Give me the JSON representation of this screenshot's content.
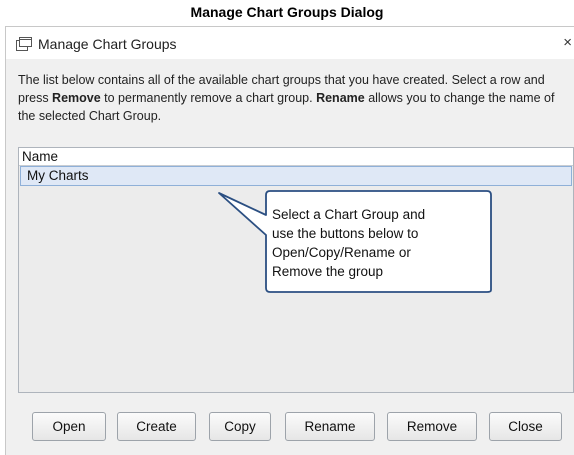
{
  "caption": "Manage Chart Groups Dialog",
  "dialog": {
    "title": "Manage Chart Groups",
    "close_glyph": "×",
    "icon": "window-icon",
    "description": {
      "p1": "The list below contains all of the available chart groups that you have created. Select a row and press ",
      "remove_word": "Remove",
      "p2": " to permanently remove a chart group. ",
      "rename_word": "Rename",
      "p3": " allows you to change the name of the selected Chart Group."
    },
    "list": {
      "column_header": "Name",
      "rows": [
        "My Charts"
      ],
      "selected_row": "My Charts"
    },
    "callout": {
      "line1": "Select a Chart Group and",
      "line2": "use the buttons below to",
      "line3": "Open/Copy/Rename or",
      "line4": "Remove the group",
      "border_color": "#2b4f82"
    },
    "buttons": {
      "open": "Open",
      "create": "Create",
      "copy": "Copy",
      "rename": "Rename",
      "remove": "Remove",
      "close": "Close"
    }
  }
}
